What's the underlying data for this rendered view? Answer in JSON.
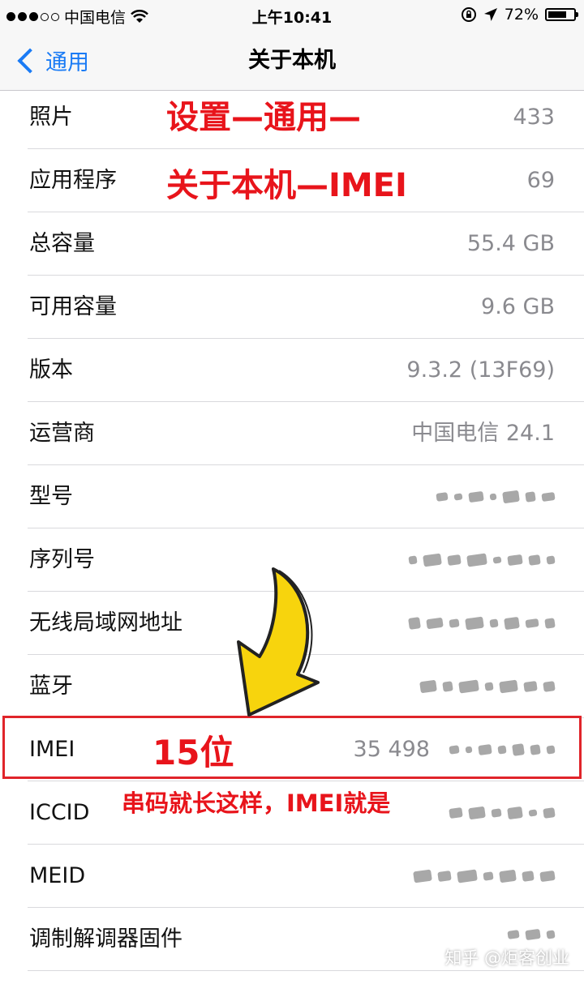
{
  "statusbar": {
    "carrier": "中国电信",
    "time": "上午10:41",
    "battery_percent": "72%",
    "battery_level": 0.72
  },
  "navbar": {
    "back_label": "通用",
    "title": "关于本机"
  },
  "rows": [
    {
      "label": "照片",
      "value": "433"
    },
    {
      "label": "应用程序",
      "value": "69"
    },
    {
      "label": "总容量",
      "value": "55.4 GB"
    },
    {
      "label": "可用容量",
      "value": "9.6 GB"
    },
    {
      "label": "版本",
      "value": "9.3.2 (13F69)"
    },
    {
      "label": "运营商",
      "value": "中国电信 24.1"
    },
    {
      "label": "型号",
      "value": ""
    },
    {
      "label": "序列号",
      "value": ""
    },
    {
      "label": "无线局域网地址",
      "value": ""
    },
    {
      "label": "蓝牙",
      "value": ""
    },
    {
      "label": "IMEI",
      "value": "35 498"
    },
    {
      "label": "ICCID",
      "value": ""
    },
    {
      "label": "MEID",
      "value": ""
    },
    {
      "label": "调制解调器固件",
      "value": ""
    }
  ],
  "annotations": {
    "line1": "设置—通用—",
    "line2": "关于本机—IMEI",
    "imei_digits": "15位",
    "imei_note": "串码就长这样，IMEI就是"
  },
  "watermark": "知乎 @炬客创业",
  "colors": {
    "accent": "#1a7bf5",
    "annotation": "#e8141b",
    "arrow": "#f7d40d"
  }
}
